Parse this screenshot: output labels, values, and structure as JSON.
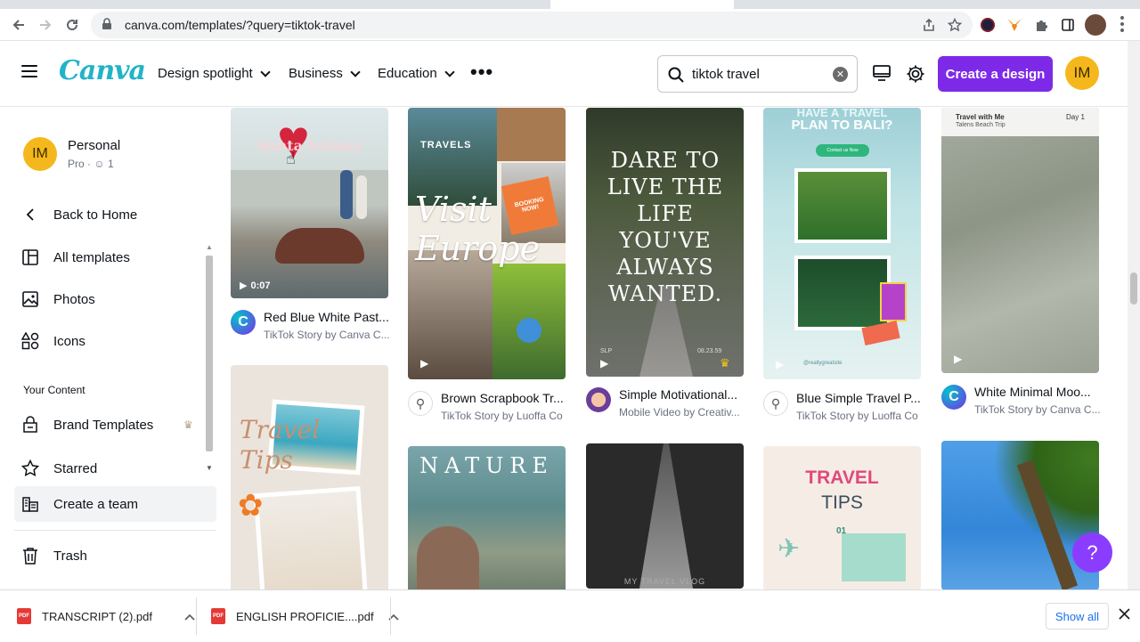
{
  "browser": {
    "url": "canva.com/templates/?query=tiktok-travel"
  },
  "header": {
    "logo": "Canva",
    "nav": [
      {
        "label": "Design spotlight"
      },
      {
        "label": "Business"
      },
      {
        "label": "Education"
      }
    ],
    "search_value": "tiktok travel",
    "create_label": "Create a design",
    "avatar_initials": "IM",
    "accent_color": "#7d2ae8"
  },
  "sidebar": {
    "team_name": "Personal",
    "team_plan": "Pro",
    "team_members": "1",
    "avatar_initials": "IM",
    "back": "Back to Home",
    "items": [
      {
        "label": "All templates",
        "icon": "template-icon"
      },
      {
        "label": "Photos",
        "icon": "photo-icon"
      },
      {
        "label": "Icons",
        "icon": "shapes-icon"
      }
    ],
    "section_title": "Your Content",
    "content_items": [
      {
        "label": "Brand Templates",
        "icon": "brand-icon"
      },
      {
        "label": "Starred",
        "icon": "star-icon"
      },
      {
        "label": "Create a team",
        "icon": "team-icon"
      },
      {
        "label": "Trash",
        "icon": "trash-icon"
      }
    ]
  },
  "templates": [
    {
      "title": "Red Blue White Past...",
      "sub": "TikTok Story by Canva C...",
      "duration": "0:07",
      "overlay": "Santa Solana"
    },
    {
      "title": "Brown Scrapbook Tr...",
      "sub": "TikTok Story by Luoffa Co",
      "overlay": "Visit Europe",
      "tag": "TRAVELS",
      "stamp": "BOOKING NOW!"
    },
    {
      "title": "Simple Motivational...",
      "sub": "Mobile Video by Creativ...",
      "overlay": "DARE TO LIVE THE LIFE YOU'VE ALWAYS WANTED.",
      "corner_left": "SLP",
      "corner_right": "08.23.59"
    },
    {
      "title": "Blue Simple Travel P...",
      "sub": "TikTok Story by Luoffa Co",
      "overlay": "PLAN TO BALI?",
      "overlay_top": "HAVE A TRAVEL",
      "pill": "Contact us Now",
      "handle": "@reallygreatsite"
    },
    {
      "title": "White Minimal Moo...",
      "sub": "TikTok Story by Canva C...",
      "overlay_left": "Travel with Me",
      "overlay_sub": "Talens Beach Trip",
      "overlay_right": "Day 1"
    },
    {
      "overlay": "Travel Tips"
    },
    {
      "overlay": "NATURE"
    },
    {
      "overlay": "MY TRAVEL VLOG"
    },
    {
      "overlay": "TRAVEL",
      "overlay2": "TIPS",
      "num": "01"
    },
    {
      "overlay": ""
    }
  ],
  "help_label": "?",
  "downloads": [
    {
      "name": "TRANSCRIPT (2).pdf"
    },
    {
      "name": "ENGLISH PROFICIE....pdf"
    }
  ],
  "pdf_badge": "PDF",
  "show_all": "Show all"
}
